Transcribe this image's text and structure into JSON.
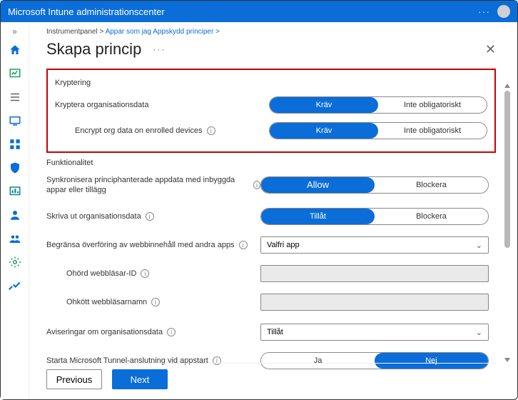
{
  "titlebar": {
    "title": "Microsoft Intune administrationscenter"
  },
  "breadcrumb": {
    "prefix": "Instrumentpanel >",
    "link": "Appar som jag Appskydd principer >"
  },
  "page": {
    "title": "Skapa princip"
  },
  "sections": {
    "encryption": {
      "label": "Kryptering",
      "row1_label": "Kryptera organisationsdata",
      "row1_opt_a": "Kräv",
      "row1_opt_b": "Inte obligatoriskt",
      "row2_label": "Encrypt org data on enrolled devices",
      "row2_opt_a": "Kräv",
      "row2_opt_b": "Inte obligatoriskt"
    },
    "functionality": {
      "label": "Funktionalitet",
      "sync_label": "Synkronisera principhanterade appdata med inbyggda appar eller tillägg",
      "sync_opt_a": "Allow",
      "sync_opt_b": "Blockera",
      "print_label": "Skriva ut organisationsdata",
      "print_opt_a": "Tillåt",
      "print_opt_b": "Blockera",
      "restrict_label": "Begränsa överföring av webbinnehåll med andra apps",
      "restrict_value": "Valfri app",
      "browser_id_label": "Ohörd webbläsar-ID",
      "browser_name_label": "Ohkött webbläsarnamn",
      "notify_label": "Aviseringar om organisationsdata",
      "notify_value": "Tillåt",
      "tunnel_label": "Starta Microsoft Tunnel-anslutning vid appstart",
      "tunnel_opt_a": "Ja",
      "tunnel_opt_b": "Nej"
    }
  },
  "footer": {
    "previous": "Previous",
    "next": "Next"
  },
  "rail_icons": [
    "home",
    "dashboard",
    "all-services",
    "devices",
    "apps",
    "endpoint-security",
    "reports",
    "users",
    "groups",
    "tenant-admin",
    "troubleshoot"
  ],
  "colors": {
    "primary": "#0a6dd8",
    "highlight_border": "#c80000"
  }
}
